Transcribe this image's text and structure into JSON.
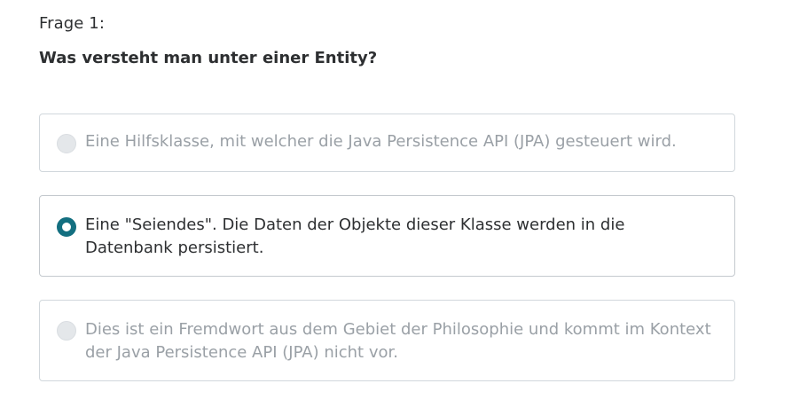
{
  "question": {
    "number_label": "Frage 1:",
    "text": "Was versteht man unter einer Entity?"
  },
  "answers": [
    {
      "label": "Eine Hilfsklasse, mit welcher die Java Persistence API (JPA) gesteuert wird.",
      "selected": false
    },
    {
      "label": "Eine \"Seiendes\". Die Daten der Objekte dieser Klasse werden in die Datenbank persistiert.",
      "selected": true
    },
    {
      "label": "Dies ist ein Fremdwort aus dem Gebiet der Philosophie und kommt im Kontext der Java Persistence API (JPA) nicht vor.",
      "selected": false
    }
  ],
  "colors": {
    "accent": "#136f80",
    "dimmed_text": "#9aa0a6",
    "border": "#d1d7dc"
  }
}
